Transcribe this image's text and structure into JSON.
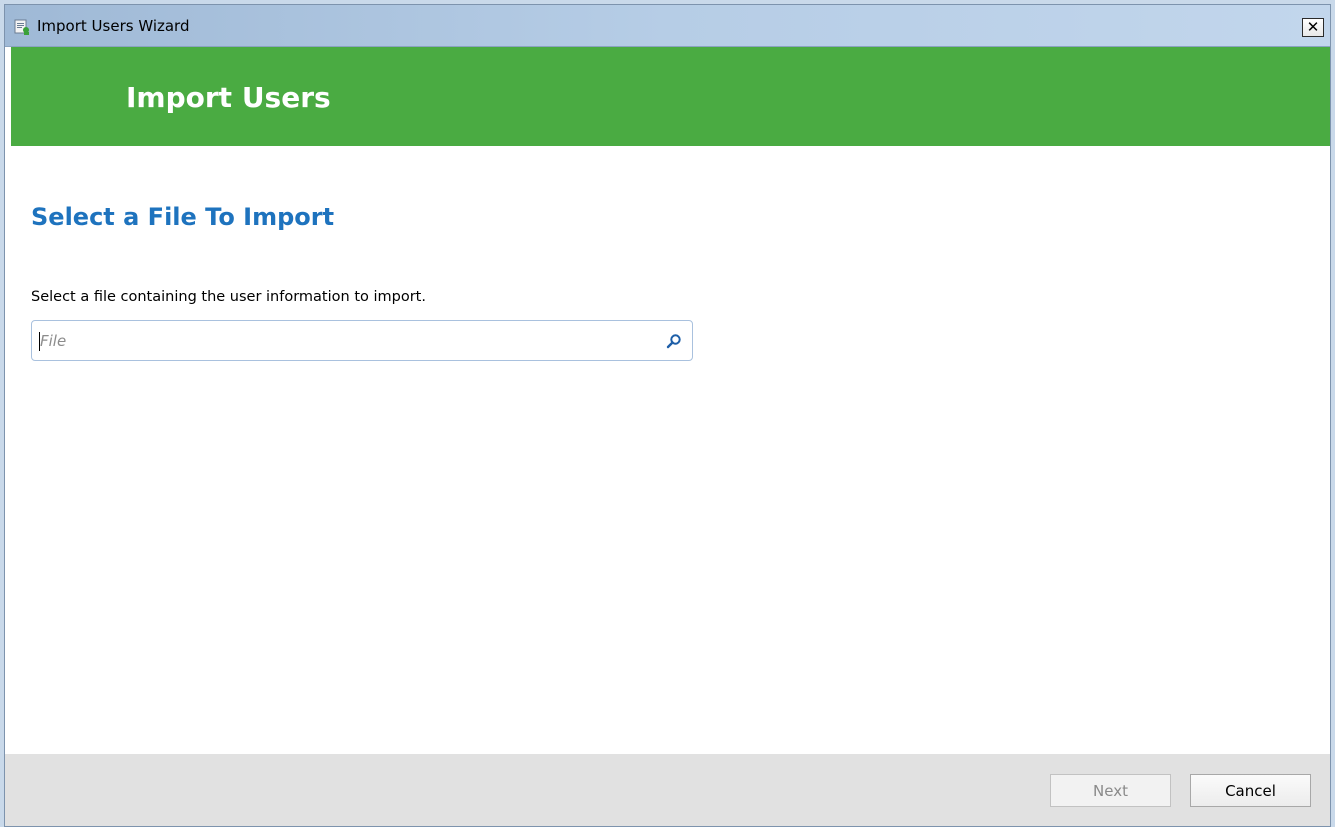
{
  "window": {
    "title": "Import Users Wizard",
    "close_glyph": "✕"
  },
  "banner": {
    "title": "Import Users",
    "color": "#4aab42"
  },
  "main": {
    "section_title": "Select a File To Import",
    "instruction": "Select a file containing the user information to import.",
    "file_input": {
      "value": "",
      "placeholder": "File",
      "icon": "search-icon"
    }
  },
  "footer": {
    "next_label": "Next",
    "next_enabled": false,
    "cancel_label": "Cancel"
  },
  "colors": {
    "accent_heading": "#1e73be",
    "footer_bg": "#e1e1e1"
  }
}
